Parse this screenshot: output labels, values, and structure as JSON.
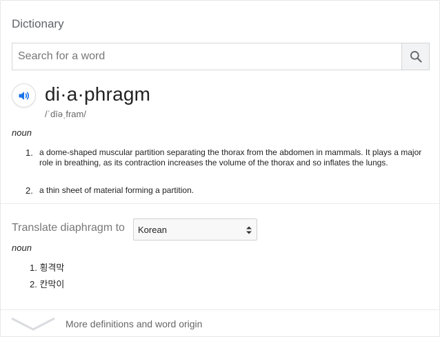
{
  "panel": {
    "title": "Dictionary"
  },
  "search": {
    "placeholder": "Search for a word"
  },
  "entry": {
    "headword": "di·a·phragm",
    "pronunciation": "/ˈdīəˌfram/",
    "part_of_speech": "noun",
    "definitions": [
      {
        "num": "1.",
        "text": "a dome-shaped muscular partition separating the thorax from the abdomen in mammals. It plays a major role in breathing, as its contraction increases the volume of the thorax and so inflates the lungs."
      },
      {
        "num": "2.",
        "text": "a thin sheet of material forming a partition."
      }
    ]
  },
  "translate": {
    "label": "Translate diaphragm to",
    "selected_language": "Korean",
    "part_of_speech": "noun",
    "items": [
      {
        "num": "1.",
        "text": "횡격막"
      },
      {
        "num": "2.",
        "text": "칸막이"
      }
    ]
  },
  "footer": {
    "more_label": "More definitions and word origin"
  },
  "colors": {
    "accent_blue": "#1a73e8",
    "muted_text": "#777777",
    "divider": "#ebebeb"
  },
  "icons": {
    "search": "search-icon",
    "speaker": "speaker-icon",
    "select": "select-arrows-icon",
    "expand": "chevron-down-icon"
  }
}
